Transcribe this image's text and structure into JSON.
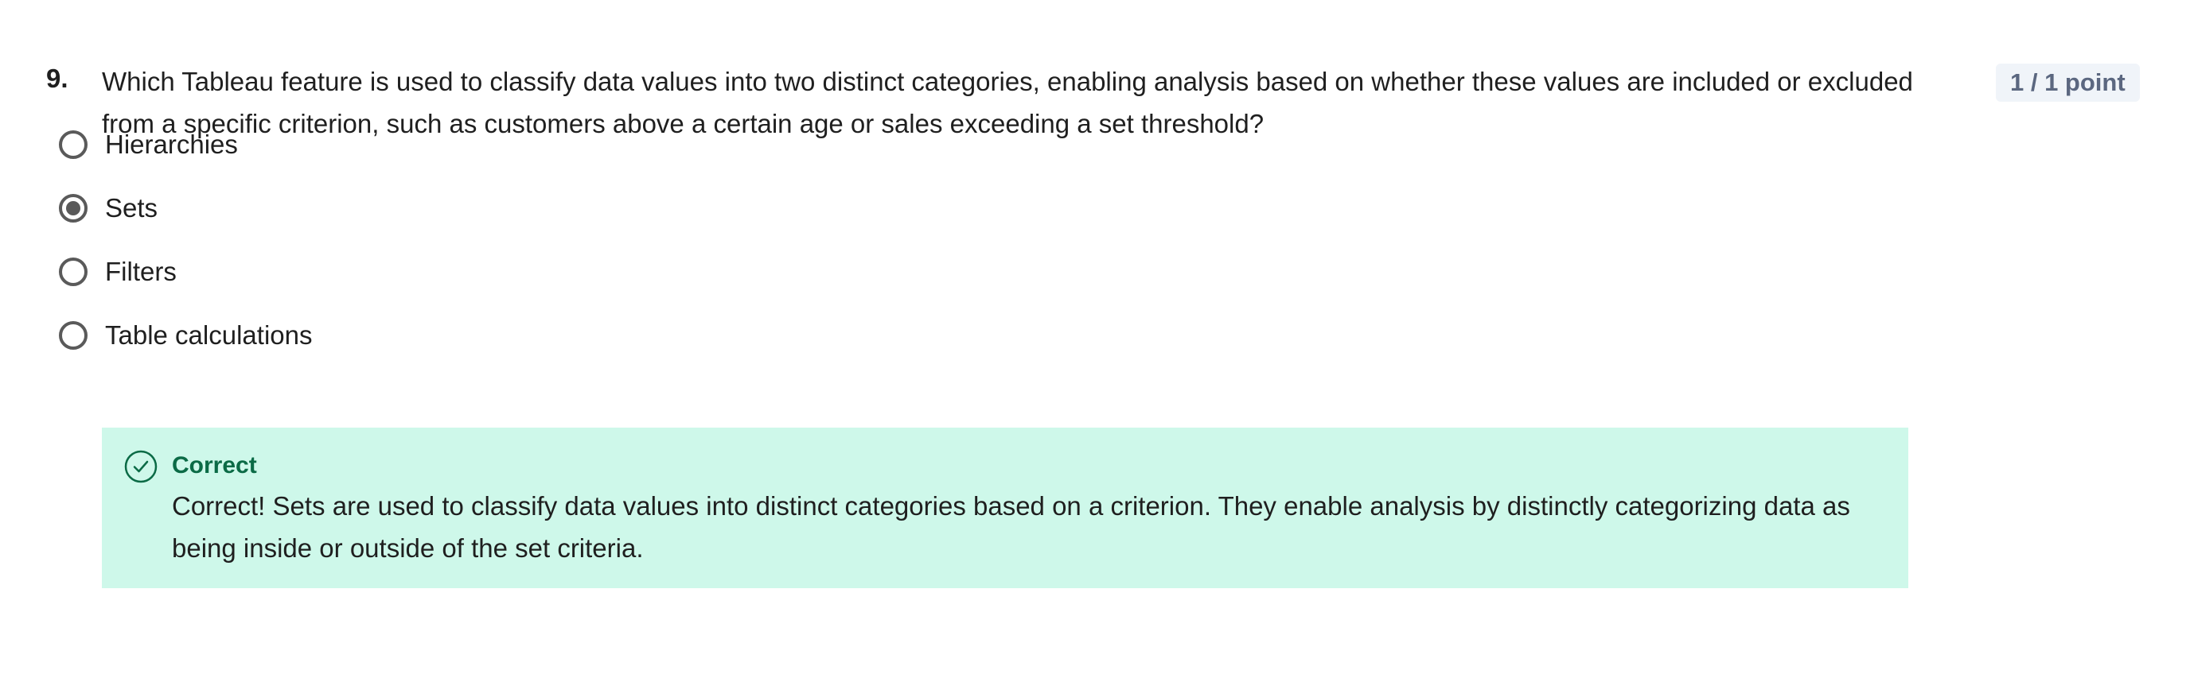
{
  "question": {
    "number": "9.",
    "text": "Which Tableau feature is used to classify data values into two distinct categories, enabling analysis based on whether these values are included or excluded from a specific criterion, such as customers above a certain age or sales exceeding a set threshold?",
    "points": "1 / 1 point"
  },
  "options": [
    {
      "label": "Hierarchies",
      "selected": false
    },
    {
      "label": "Sets",
      "selected": true
    },
    {
      "label": "Filters",
      "selected": false
    },
    {
      "label": "Table calculations",
      "selected": false
    }
  ],
  "feedback": {
    "status": "Correct",
    "icon": "check-circle-icon",
    "color": "#0b6b46",
    "background": "#cef8ea",
    "text": "Correct! Sets are used to classify data values into distinct categories based on a criterion. They enable analysis by distinctly categorizing data as being inside or outside of the set criteria."
  }
}
